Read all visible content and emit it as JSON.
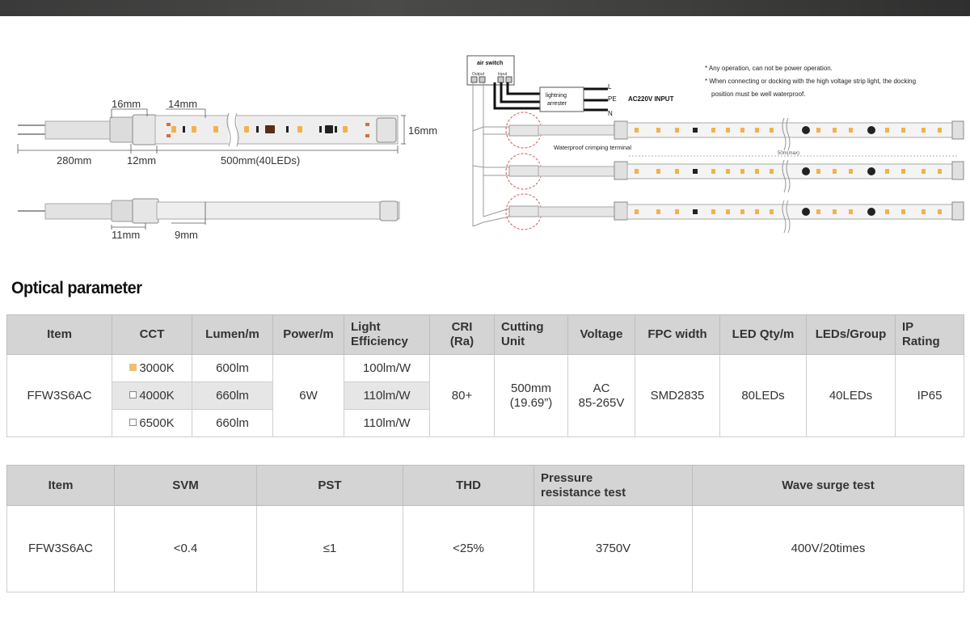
{
  "dimensions": {
    "top_16": "16mm",
    "top_14": "14mm",
    "right_16": "16mm",
    "len_280": "280mm",
    "len_12": "12mm",
    "len_500": "500mm(40LEDs)",
    "len_11": "11mm",
    "len_9": "9mm"
  },
  "wiring": {
    "air_switch": "air switch",
    "output": "Output",
    "input": "Input",
    "arrester_line1": "lightning",
    "arrester_line2": "arrester",
    "L": "L",
    "PE": "PE",
    "N": "N",
    "ac_input": "AC220V INPUT",
    "note1": "* Any operation, can not be power operation.",
    "note2": "* When connecting or docking with the high voltage strip light, the docking",
    "note3": "position must be well waterproof.",
    "terminal_label": "Waterproof crimping terminal",
    "max_len": "50m(max)"
  },
  "section_title": "Optical parameter",
  "table1": {
    "headers": {
      "item": "Item",
      "cct": "CCT",
      "lumen": "Lumen/m",
      "power": "Power/m",
      "efficiency_1": "Light",
      "efficiency_2": "Efficiency",
      "cri_1": "CRI",
      "cri_2": "(Ra)",
      "cutting_1": "Cutting",
      "cutting_2": "Unit",
      "voltage": "Voltage",
      "fpc": "FPC width",
      "ledqty": "LED Qty/m",
      "ledgroup": "LEDs/Group",
      "ip_1": "IP",
      "ip_2": "Rating"
    },
    "item": "FFW3S6AC",
    "rows": [
      {
        "cct": "3000K",
        "lumen": "600lm",
        "efficiency": "100lm/W",
        "swatch": "#f0c070"
      },
      {
        "cct": "4000K",
        "lumen": "660lm",
        "efficiency": "110lm/W"
      },
      {
        "cct": "6500K",
        "lumen": "660lm",
        "efficiency": "110lm/W"
      }
    ],
    "power": "6W",
    "cri": "80+",
    "cutting_1": "500mm",
    "cutting_2": "(19.69”)",
    "voltage_1": "AC",
    "voltage_2": "85-265V",
    "fpc": "SMD2835",
    "ledqty": "80LEDs",
    "ledgroup": "40LEDs",
    "ip": "IP65"
  },
  "table2": {
    "headers": {
      "item": "Item",
      "svm": "SVM",
      "pst": "PST",
      "thd": "THD",
      "pressure_1": "Pressure",
      "pressure_2": "resistance test",
      "surge": "Wave surge test"
    },
    "item": "FFW3S6AC",
    "svm": "<0.4",
    "pst": "≤1",
    "thd": "<25%",
    "pressure": "3750V",
    "surge": "400V/20times"
  }
}
